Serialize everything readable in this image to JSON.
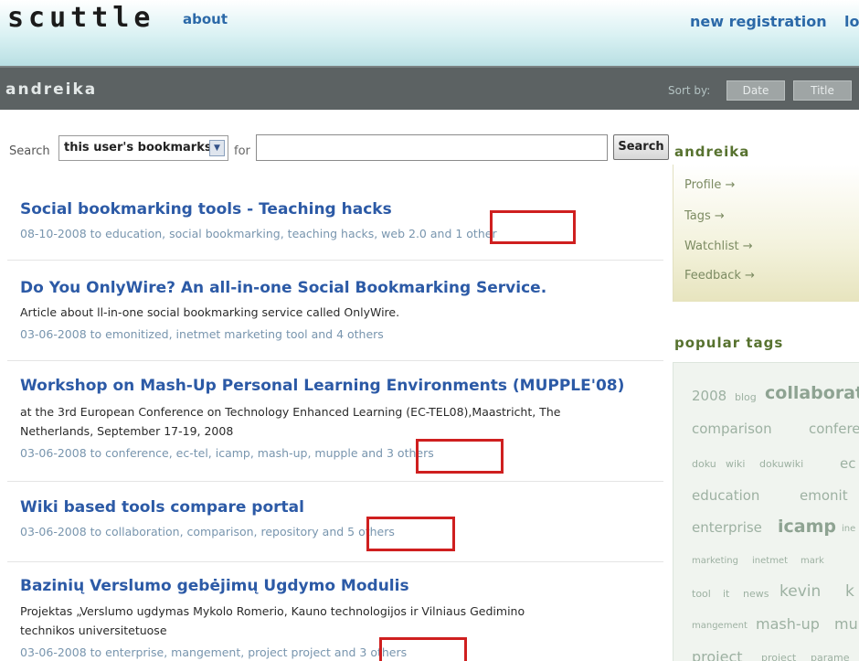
{
  "header": {
    "logo": "scuttle",
    "about": "about",
    "new_registration": "new registration",
    "login_partial": "lo"
  },
  "user_bar": {
    "username": "andreika",
    "sort_by": "Sort by:",
    "sort_date": "Date",
    "sort_title": "Title"
  },
  "search": {
    "label": "Search",
    "scope": "this user's bookmarks",
    "for_label": "for",
    "value": "",
    "button": "Search"
  },
  "bookmarks": [
    {
      "title": "Social bookmarking tools - Teaching hacks",
      "desc_lines": [],
      "meta_prefix": "08-10-2008 to education, social bookmarking, teaching hacks, web 2.0 ",
      "meta_more": "and 1 other"
    },
    {
      "title": "Do You OnlyWire? An all-in-one Social Bookmarking Service.",
      "desc_lines": [
        "Article about ll-in-one social bookmarking service called OnlyWire."
      ],
      "meta_prefix": "03-06-2008 to emonitized, inetmet marketing tool ",
      "meta_more": "and 4 others"
    },
    {
      "title": "Workshop on Mash-Up Personal Learning Environments (MUPPLE'08)",
      "desc_lines": [
        "at the 3rd European Conference on Technology Enhanced Learning (EC-TEL08),Maastricht, The",
        "Netherlands, September 17-19, 2008"
      ],
      "meta_prefix": "03-06-2008 to conference, ec-tel, icamp, mash-up, mupple ",
      "meta_more": "and 3 others"
    },
    {
      "title": "Wiki based tools compare portal",
      "desc_lines": [],
      "meta_prefix": "03-06-2008 to collaboration, comparison, repository ",
      "meta_more": "and 5 others"
    },
    {
      "title": "Bazinių Verslumo gebėjimų Ugdymo Modulis",
      "desc_lines": [
        "Projektas „Verslumo ugdymas Mykolo Romerio, Kauno technologijos ir Vilniaus Gedimino",
        "technikos universitetuose"
      ],
      "meta_prefix": "03-06-2008 to enterprise, mangement, project project ",
      "meta_more": "and 3 others"
    }
  ],
  "sidebar": {
    "user_title": "andreika",
    "links": [
      "Profile →",
      "Tags →",
      "Watchlist →",
      "Feedback →"
    ],
    "popular_tags_title": "popular tags",
    "tags": [
      "2008",
      "blog",
      "collaborat",
      "comparison",
      "confere",
      "doku",
      "wiki",
      "dokuwiki",
      "ec",
      "education",
      "emonit",
      "enterprise",
      "icamp",
      "ine",
      "marketing",
      "inetmet",
      "mark",
      "tool",
      "it",
      "news",
      "kevin",
      "k",
      "mangement",
      "mash-up",
      "mu",
      "project",
      "project",
      "parame"
    ]
  },
  "colors": {
    "link_blue": "#2c5aa6",
    "meta_blue": "#7895ae",
    "highlight_red": "#cf1f1f",
    "user_bar": "#5c6263",
    "sidebar_green": "#57722f"
  }
}
